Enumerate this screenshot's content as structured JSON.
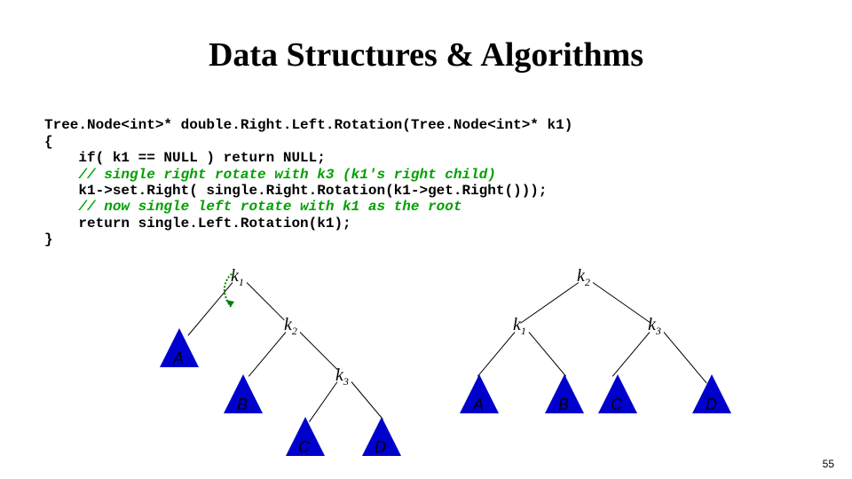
{
  "title": "Data Structures & Algorithms",
  "code": {
    "sig": "Tree.Node<int>* double.Right.Left.Rotation(Tree.Node<int>* k1)",
    "open": "{",
    "l1": "    if( k1 == NULL ) return NULL;",
    "c1": "    // single right rotate with k3 (k1's right child)",
    "l2": "    k1->set.Right( single.Right.Rotation(k1->get.Right()));",
    "c2": "    // now single left rotate with k1 as the root",
    "l3": "    return single.Left.Rotation(k1);",
    "close": "}"
  },
  "left_tree": {
    "k1": "k",
    "k1_sub": "1",
    "k2": "k",
    "k2_sub": "2",
    "k3": "k",
    "k3_sub": "3",
    "A": "A",
    "B": "B",
    "C": "C",
    "D": "D"
  },
  "right_tree": {
    "k2": "k",
    "k2_sub": "2",
    "k1": "k",
    "k1_sub": "1",
    "k3": "k",
    "k3_sub": "3",
    "A": "A",
    "B": "B",
    "C": "C",
    "D": "D"
  },
  "page": "55"
}
